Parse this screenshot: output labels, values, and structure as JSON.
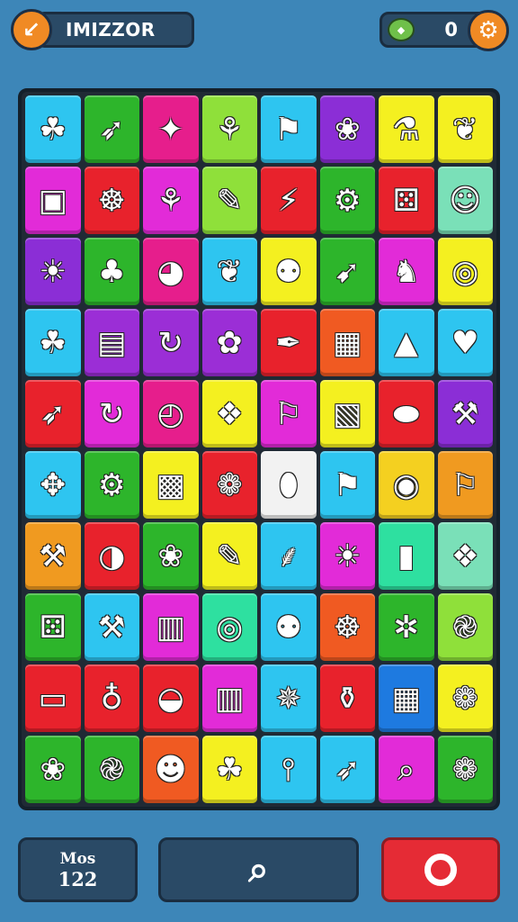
{
  "header": {
    "back_icon": "back-arrow-icon",
    "title": "IMIZZOR",
    "score_icon": "gem-icon",
    "score": "0",
    "settings_icon": "gear-icon"
  },
  "board": {
    "rows": [
      [
        {
          "color": "#2ec5f0",
          "icon": "leaf"
        },
        {
          "color": "#2db52b",
          "icon": "arrow"
        },
        {
          "color": "#e61e8c",
          "icon": "star"
        },
        {
          "color": "#8fe03a",
          "icon": "basket"
        },
        {
          "color": "#2ec5f0",
          "icon": "flag"
        },
        {
          "color": "#8b2ed6",
          "icon": "wing"
        },
        {
          "color": "#f4f020",
          "icon": "cream"
        },
        {
          "color": "#f4f020",
          "icon": "bird"
        }
      ],
      [
        {
          "color": "#e22bd8",
          "icon": "box"
        },
        {
          "color": "#e8222c",
          "icon": "wheel"
        },
        {
          "color": "#e22bd8",
          "icon": "plant"
        },
        {
          "color": "#8fe03a",
          "icon": "brush"
        },
        {
          "color": "#e8222c",
          "icon": "plug"
        },
        {
          "color": "#2db52b",
          "icon": "gear"
        },
        {
          "color": "#e8222c",
          "icon": "dice"
        },
        {
          "color": "#7ae0b8",
          "icon": "sun-face"
        }
      ],
      [
        {
          "color": "#8b2ed6",
          "icon": "sun"
        },
        {
          "color": "#2db52b",
          "icon": "tree"
        },
        {
          "color": "#e61e8c",
          "icon": "ball"
        },
        {
          "color": "#2ec5f0",
          "icon": "bird"
        },
        {
          "color": "#f4f020",
          "icon": "balloon"
        },
        {
          "color": "#2db52b",
          "icon": "rocket"
        },
        {
          "color": "#e22bd8",
          "icon": "lion"
        },
        {
          "color": "#f4f020",
          "icon": "lantern"
        }
      ],
      [
        {
          "color": "#2ec5f0",
          "icon": "leaf"
        },
        {
          "color": "#9b2ed6",
          "icon": "camera"
        },
        {
          "color": "#9b2ed6",
          "icon": "refresh"
        },
        {
          "color": "#9b2ed6",
          "icon": "flowers"
        },
        {
          "color": "#e8222c",
          "icon": "feather"
        },
        {
          "color": "#f05a22",
          "icon": "cube"
        },
        {
          "color": "#2ec5f0",
          "icon": "tent"
        },
        {
          "color": "#2ec5f0",
          "icon": "heart"
        }
      ],
      [
        {
          "color": "#e8222c",
          "icon": "arrow"
        },
        {
          "color": "#e22bd8",
          "icon": "refresh"
        },
        {
          "color": "#e61e8c",
          "icon": "clock"
        },
        {
          "color": "#f4f020",
          "icon": "gift"
        },
        {
          "color": "#e22bd8",
          "icon": "pin"
        },
        {
          "color": "#f4f020",
          "icon": "chest"
        },
        {
          "color": "#e8222c",
          "icon": "rugby"
        },
        {
          "color": "#8b2ed6",
          "icon": "tools"
        }
      ],
      [
        {
          "color": "#2ec5f0",
          "icon": "bag"
        },
        {
          "color": "#2db52b",
          "icon": "gear"
        },
        {
          "color": "#f4f020",
          "icon": "robot"
        },
        {
          "color": "#e8222c",
          "icon": "flower"
        },
        {
          "color": "#f2f2f2",
          "icon": "vase"
        },
        {
          "color": "#2ec5f0",
          "icon": "flag"
        },
        {
          "color": "#f4d020",
          "icon": "disk"
        },
        {
          "color": "#f09a20",
          "icon": "pin"
        }
      ],
      [
        {
          "color": "#f09a20",
          "icon": "hammer"
        },
        {
          "color": "#e8222c",
          "icon": "globe"
        },
        {
          "color": "#2db52b",
          "icon": "rose"
        },
        {
          "color": "#f4f020",
          "icon": "brush"
        },
        {
          "color": "#2ec5f0",
          "icon": "palm"
        },
        {
          "color": "#e22bd8",
          "icon": "sun"
        },
        {
          "color": "#2ee0a0",
          "icon": "capsule"
        },
        {
          "color": "#7ae0b8",
          "icon": "puzzle"
        }
      ],
      [
        {
          "color": "#2db52b",
          "icon": "dice"
        },
        {
          "color": "#2ec5f0",
          "icon": "wrench"
        },
        {
          "color": "#e22bd8",
          "icon": "book"
        },
        {
          "color": "#2ee0a0",
          "icon": "target"
        },
        {
          "color": "#2ec5f0",
          "icon": "lollipop"
        },
        {
          "color": "#f05a22",
          "icon": "wheel"
        },
        {
          "color": "#2db52b",
          "icon": "compass"
        },
        {
          "color": "#8fe03a",
          "icon": "swirl"
        }
      ],
      [
        {
          "color": "#e8222c",
          "icon": "card"
        },
        {
          "color": "#e8222c",
          "icon": "planet"
        },
        {
          "color": "#e8222c",
          "icon": "leaf-ball"
        },
        {
          "color": "#e22bd8",
          "icon": "door"
        },
        {
          "color": "#2ec5f0",
          "icon": "mandala"
        },
        {
          "color": "#e8222c",
          "icon": "pot"
        },
        {
          "color": "#1e7ae0",
          "icon": "calendar"
        },
        {
          "color": "#f4f020",
          "icon": "flower"
        }
      ],
      [
        {
          "color": "#2db52b",
          "icon": "rose"
        },
        {
          "color": "#2db52b",
          "icon": "swirl"
        },
        {
          "color": "#f05a22",
          "icon": "mascot"
        },
        {
          "color": "#f4f020",
          "icon": "leaf"
        },
        {
          "color": "#2ec5f0",
          "icon": "fountain"
        },
        {
          "color": "#2ec5f0",
          "icon": "arrow"
        },
        {
          "color": "#e22bd8",
          "icon": "magnifier"
        },
        {
          "color": "#2db52b",
          "icon": "flower"
        }
      ]
    ]
  },
  "footer": {
    "moves_label": "Mos",
    "moves_value": "122",
    "hint_icon": "magnifier-icon",
    "action_icon": "target-icon"
  }
}
